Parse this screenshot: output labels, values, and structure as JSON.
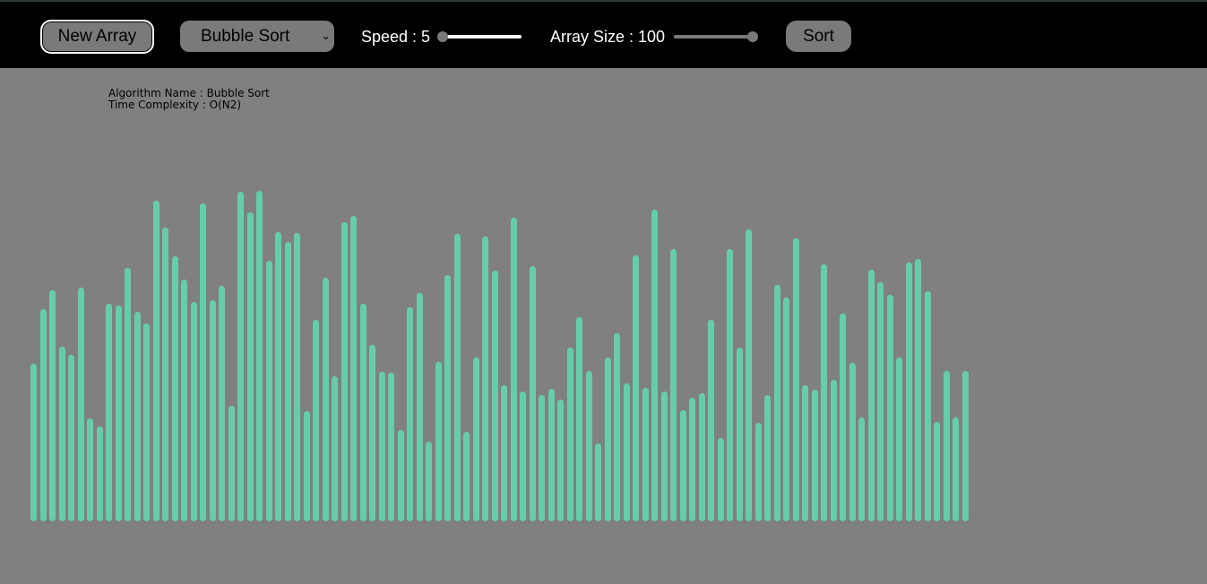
{
  "toolbar": {
    "new_array_label": "New Array",
    "algorithm_selected": "Bubble Sort",
    "speed_label": "Speed : 5",
    "speed_value": 5,
    "speed_fraction": 0.0,
    "array_size_label": "Array Size : 100",
    "array_size_value": 100,
    "array_size_fraction": 1.0,
    "sort_label": "Sort"
  },
  "info": {
    "algorithm_line": "Algorithm Name : Bubble Sort",
    "complexity_line": "Time Complexity : O(N2)"
  },
  "colors": {
    "background": "#808080",
    "topbar": "#000000",
    "bar": "#66cdaa",
    "control": "#7a7a7a"
  },
  "array": {
    "values": [
      176,
      237,
      258,
      195,
      186,
      261,
      115,
      106,
      243,
      241,
      283,
      234,
      221,
      358,
      328,
      296,
      270,
      245,
      355,
      247,
      263,
      129,
      368,
      345,
      369,
      291,
      323,
      312,
      322,
      123,
      225,
      272,
      162,
      334,
      341,
      243,
      197,
      167,
      166,
      102,
      239,
      255,
      89,
      178,
      275,
      321,
      100,
      183,
      318,
      280,
      152,
      339,
      145,
      285,
      141,
      148,
      136,
      194,
      228,
      168,
      87,
      183,
      210,
      154,
      297,
      149,
      348,
      145,
      304,
      124,
      138,
      143,
      225,
      93,
      304,
      194,
      326,
      110,
      141,
      264,
      250,
      316,
      152,
      147,
      287,
      158,
      232,
      177,
      116,
      281,
      267,
      253,
      183,
      289,
      293,
      257,
      111,
      168,
      116,
      168
    ]
  }
}
